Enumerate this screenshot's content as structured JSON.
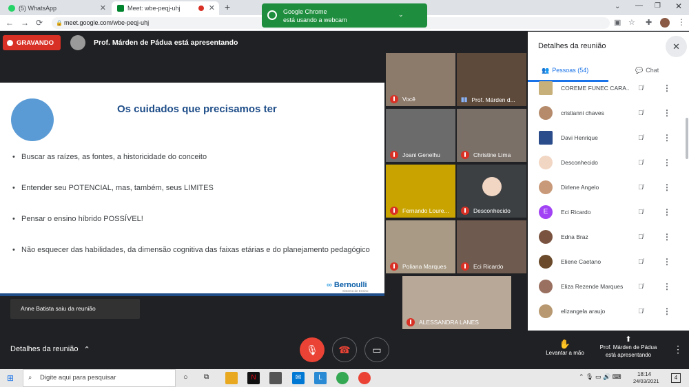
{
  "tabs": [
    {
      "label": "(5) WhatsApp"
    },
    {
      "label": "Meet: wbe-peqj-uhj"
    }
  ],
  "address": {
    "url": "meet.google.com/wbe-peqj-uhj"
  },
  "notification": {
    "line1": "Google Chrome",
    "line2": "está usando a webcam"
  },
  "recording": {
    "label": "GRAVANDO"
  },
  "presenter_banner": "Prof. Márden de Pádua está apresentando",
  "slide": {
    "title": "Os cuidados que precisamos ter",
    "bullets": [
      "Buscar as raízes, as fontes, a historicidade do conceito",
      "Entender seu POTENCIAL, mas, também, seus LIMITES",
      "Pensar o ensino híbrido POSSÍVEL!",
      "Não esquecer das habilidades, da dimensão cognitiva das faixas etárias e do planejamento pedagógico"
    ],
    "logo": "Bernoulli",
    "logo_sub": "Sistema de Ensino"
  },
  "toast": "Anne Batista saiu da reunião",
  "tiles": [
    "Você",
    "Prof. Márden d...",
    "Joani Genelhu",
    "Christine Lima",
    "Fernando Loure...",
    "Desconhecido",
    "Poliana Marques",
    "Eci Ricardo",
    "ALESSANDRA LANES"
  ],
  "panel": {
    "title": "Detalhes da reunião",
    "tab_people": "Pessoas (54)",
    "tab_chat": "Chat",
    "people": [
      "COREME FUNEC CARA...",
      "cristianni chaves",
      "Davi Henrique",
      "Desconhecido",
      "Dirlene Angelo",
      "Eci Ricardo",
      "Edna Braz",
      "Eliene Caetano",
      "Eliza Rezende Marques",
      "elizangela araujo"
    ],
    "avatar_letter": "E"
  },
  "controls": {
    "details": "Detalhes da reunião",
    "raise_hand": "Levantar a mão",
    "presenting": "Prof. Márden de Pádua",
    "presenting2": "está apresentando"
  },
  "taskbar": {
    "search": "Digite aqui para pesquisar",
    "time": "18:14",
    "date": "24/03/2021",
    "badge": "4"
  }
}
